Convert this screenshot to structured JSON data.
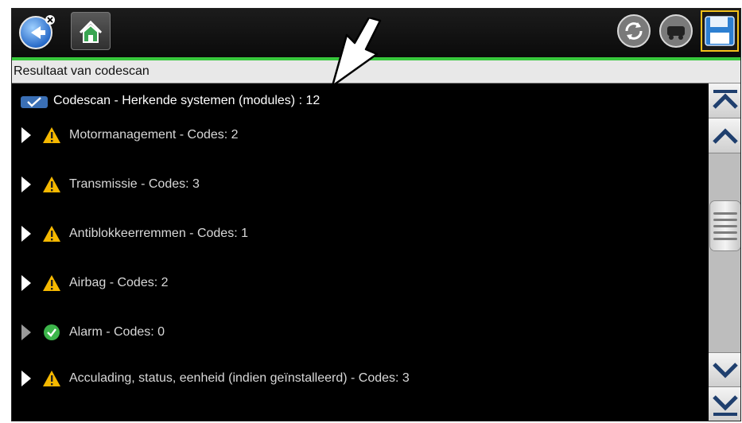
{
  "header": {
    "title": "Resultaat van codescan"
  },
  "summary": {
    "label": "Codescan - Herkende systemen (modules) : 12"
  },
  "systems": [
    {
      "label": "Motormanagement - Codes: 2",
      "status": "warning"
    },
    {
      "label": "Transmissie - Codes: 3",
      "status": "warning"
    },
    {
      "label": "Antiblokkeerremmen - Codes: 1",
      "status": "warning"
    },
    {
      "label": "Airbag - Codes: 2",
      "status": "warning"
    },
    {
      "label": "Alarm - Codes: 0",
      "status": "ok"
    },
    {
      "label": "Acculading, status, eenheid (indien geïnstalleerd) - Codes: 3",
      "status": "warning"
    }
  ],
  "colors": {
    "accent_green": "#38c83c",
    "warning": "#f5b800",
    "ok": "#3cb54a",
    "save_border": "#f4c21a"
  },
  "icons": {
    "toolbar": [
      "back-icon",
      "home-icon",
      "refresh-icon",
      "vehicle-icon",
      "save-icon"
    ],
    "scroll": [
      "scroll-top-icon",
      "scroll-up-icon",
      "scroll-down-icon",
      "scroll-bottom-icon"
    ]
  }
}
